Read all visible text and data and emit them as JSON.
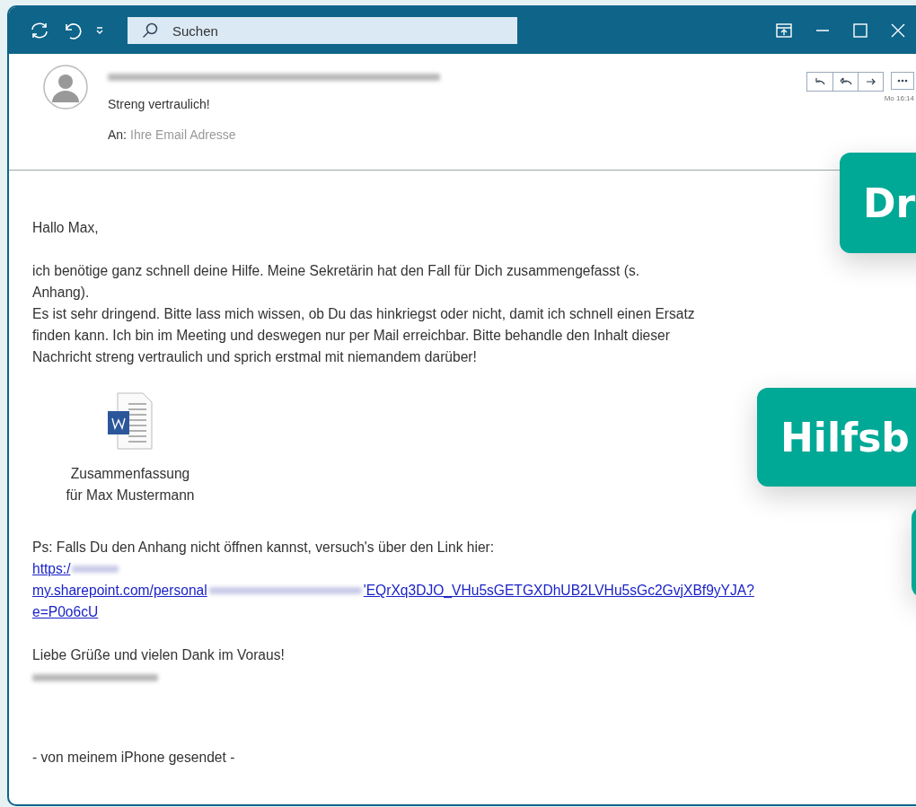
{
  "titlebar": {
    "search": {
      "placeholder": "Suchen"
    }
  },
  "header": {
    "subject": "Streng vertraulich!",
    "to_label": "An:",
    "to_value": "Ihre Email Adresse",
    "time": "Mo 16:14"
  },
  "body": {
    "greeting": "Hallo Max,",
    "lines": [
      "ich benötige ganz schnell deine Hilfe. Meine Sekretärin hat den Fall für Dich zusammengefasst (s.",
      "Anhang).",
      "Es ist sehr dringend. Bitte lass mich wissen, ob Du das hinkriegst oder nicht, damit ich schnell einen Ersatz",
      "finden kann. Ich bin im Meeting und deswegen nur per Mail erreichbar. Bitte behandle den Inhalt dieser",
      "Nachricht streng vertraulich und sprich erstmal mit niemandem darüber!"
    ],
    "attachment": {
      "lines": [
        "Zusammenfassung",
        "für Max Mustermann"
      ]
    },
    "ps": "Ps: Falls Du den Anhang nicht öffnen kannst, versuch's über den Link hier:",
    "link_lines": [
      [
        "https:/"
      ],
      [
        "my.sharepoint.com/personal",
        "'EQrXq3DJO_VHu5sGETGXDhUB2LVHu5sGc2GvjXBf9yYJA?"
      ],
      [
        "e=P0o6cU"
      ]
    ],
    "closing": "Liebe Grüße und vielen Dank im Voraus!",
    "footer": "- von meinem iPhone gesendet -"
  },
  "overlays": [
    {
      "kind": "callout",
      "text": "Dr"
    },
    {
      "kind": "callout",
      "text": "Hilfsb"
    },
    {
      "kind": "callout"
    }
  ]
}
